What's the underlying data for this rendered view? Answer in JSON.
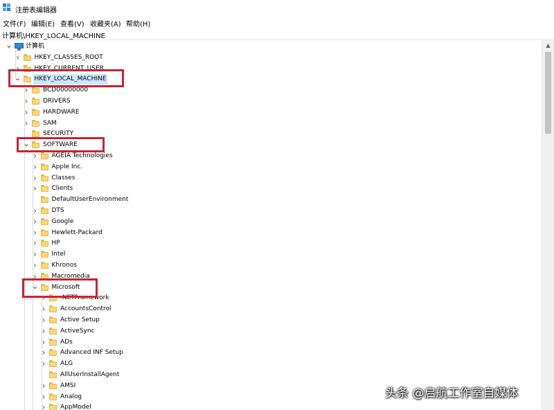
{
  "window": {
    "title": "注册表编辑器"
  },
  "menu": [
    "文件(F)",
    "编辑(E)",
    "查看(V)",
    "收藏夹(A)",
    "帮助(H)"
  ],
  "address": "计算机\\HKEY_LOCAL_MACHINE",
  "colors": {
    "highlight": "#c8242f",
    "folder": "#f8d775",
    "selection": "#cce8ff"
  },
  "tree": [
    {
      "label": "计算机",
      "icon": "computer-icon",
      "expanded": true
    },
    {
      "label": "HKEY_CLASSES_ROOT",
      "icon": "folder-icon",
      "expanded": false
    },
    {
      "label": "HKEY_CURRENT_USER",
      "icon": "folder-icon",
      "expanded": false
    },
    {
      "label": "HKEY_LOCAL_MACHINE",
      "icon": "folder-icon",
      "expanded": true,
      "selected": true
    },
    {
      "label": "BCD00000000",
      "icon": "folder-icon",
      "expanded": false
    },
    {
      "label": "DRIVERS",
      "icon": "folder-icon",
      "expanded": false
    },
    {
      "label": "HARDWARE",
      "icon": "folder-icon",
      "expanded": false
    },
    {
      "label": "SAM",
      "icon": "folder-icon",
      "expanded": false
    },
    {
      "label": "SECURITY",
      "icon": "folder-icon",
      "expanded": null
    },
    {
      "label": "SOFTWARE",
      "icon": "folder-icon",
      "expanded": true
    },
    {
      "label": "AGEIA Technologies",
      "icon": "folder-icon",
      "expanded": false
    },
    {
      "label": "Apple Inc.",
      "icon": "folder-icon",
      "expanded": false
    },
    {
      "label": "Classes",
      "icon": "folder-icon",
      "expanded": false
    },
    {
      "label": "Clients",
      "icon": "folder-icon",
      "expanded": false
    },
    {
      "label": "DefaultUserEnvironment",
      "icon": "folder-icon",
      "expanded": null
    },
    {
      "label": "DTS",
      "icon": "folder-icon",
      "expanded": false
    },
    {
      "label": "Google",
      "icon": "folder-icon",
      "expanded": false
    },
    {
      "label": "Hewlett-Packard",
      "icon": "folder-icon",
      "expanded": false
    },
    {
      "label": "HP",
      "icon": "folder-icon",
      "expanded": false
    },
    {
      "label": "Intel",
      "icon": "folder-icon",
      "expanded": false
    },
    {
      "label": "Khronos",
      "icon": "folder-icon",
      "expanded": false
    },
    {
      "label": "Macromedia",
      "icon": "folder-icon",
      "expanded": false
    },
    {
      "label": "Microsoft",
      "icon": "folder-icon",
      "expanded": true
    },
    {
      "label": ".NETFramework",
      "icon": "folder-icon",
      "expanded": false
    },
    {
      "label": "AccountsControl",
      "icon": "folder-icon",
      "expanded": false
    },
    {
      "label": "Active Setup",
      "icon": "folder-icon",
      "expanded": false
    },
    {
      "label": "ActiveSync",
      "icon": "folder-icon",
      "expanded": false
    },
    {
      "label": "ADs",
      "icon": "folder-icon",
      "expanded": false
    },
    {
      "label": "Advanced INF Setup",
      "icon": "folder-icon",
      "expanded": false
    },
    {
      "label": "ALG",
      "icon": "folder-icon",
      "expanded": false
    },
    {
      "label": "AllUserInstallAgent",
      "icon": "folder-icon",
      "expanded": null
    },
    {
      "label": "AMSI",
      "icon": "folder-icon",
      "expanded": false
    },
    {
      "label": "Analog",
      "icon": "folder-icon",
      "expanded": false
    },
    {
      "label": "AppModel",
      "icon": "folder-icon",
      "expanded": false
    }
  ],
  "watermark": "头条 @启航工作室自媒体"
}
